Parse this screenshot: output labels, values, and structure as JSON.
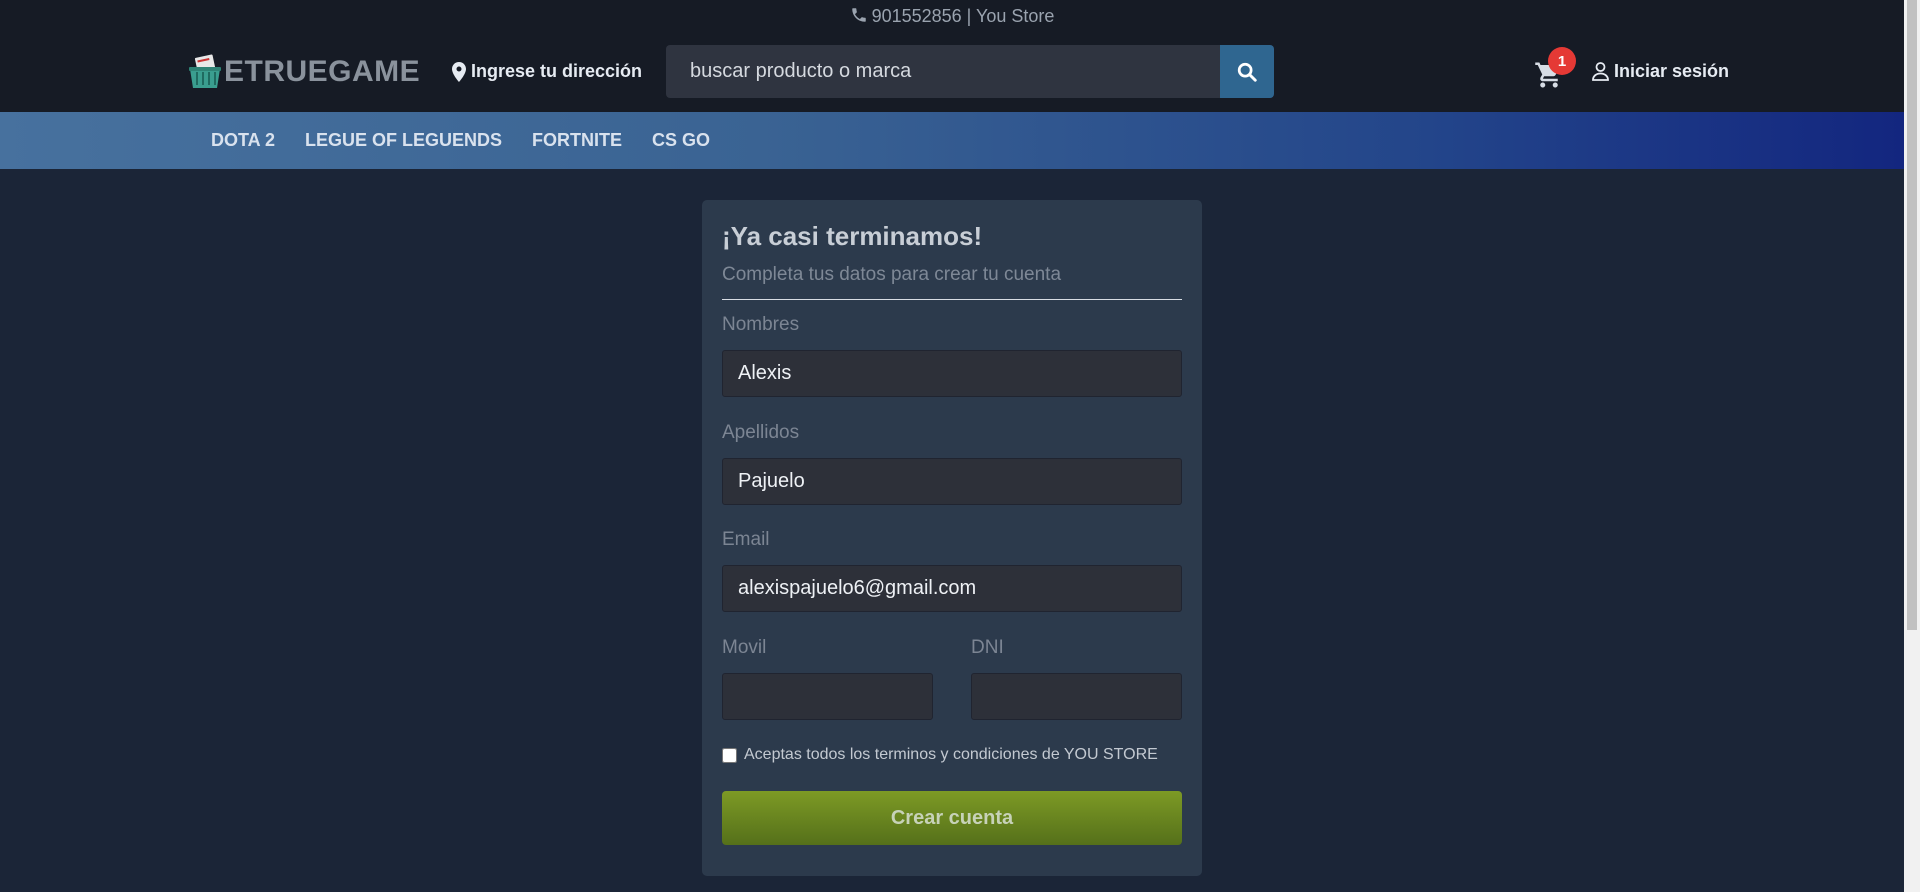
{
  "header": {
    "phone_text": "901552856 | You Store",
    "logo_text": "ETRUEGAME",
    "address_label": "Ingrese tu dirección",
    "search_placeholder": "buscar producto o marca",
    "cart_count": "1",
    "login_label": "Iniciar sesión"
  },
  "nav": {
    "items": [
      "DOTA 2",
      "LEGUE OF LEGUENDS",
      "FORTNITE",
      "CS GO"
    ]
  },
  "form": {
    "title": "¡Ya casi terminamos!",
    "subtitle": "Completa tus datos para crear tu cuenta",
    "fields": {
      "nombres": {
        "label": "Nombres",
        "value": "Alexis"
      },
      "apellidos": {
        "label": "Apellidos",
        "value": "Pajuelo"
      },
      "email": {
        "label": "Email",
        "value": "alexispajuelo6@gmail.com"
      },
      "movil": {
        "label": "Movil",
        "value": ""
      },
      "dni": {
        "label": "DNI",
        "value": ""
      }
    },
    "terms_label": "Aceptas todos los terminos y condiciones de YOU STORE",
    "terms_checked": false,
    "submit_label": "Crear cuenta"
  },
  "colors": {
    "page_bg": "#1b2537",
    "header_bg": "#161b25",
    "card_bg": "#2c3a4c",
    "accent_search": "#2f6690",
    "submit_green": "#6b8a1f",
    "badge_red": "#e53935"
  },
  "icons": {
    "phone": "phone-icon",
    "logo": "basket-logo-icon",
    "address": "map-marker-icon",
    "search": "search-icon",
    "cart": "cart-icon",
    "login": "user-icon"
  }
}
